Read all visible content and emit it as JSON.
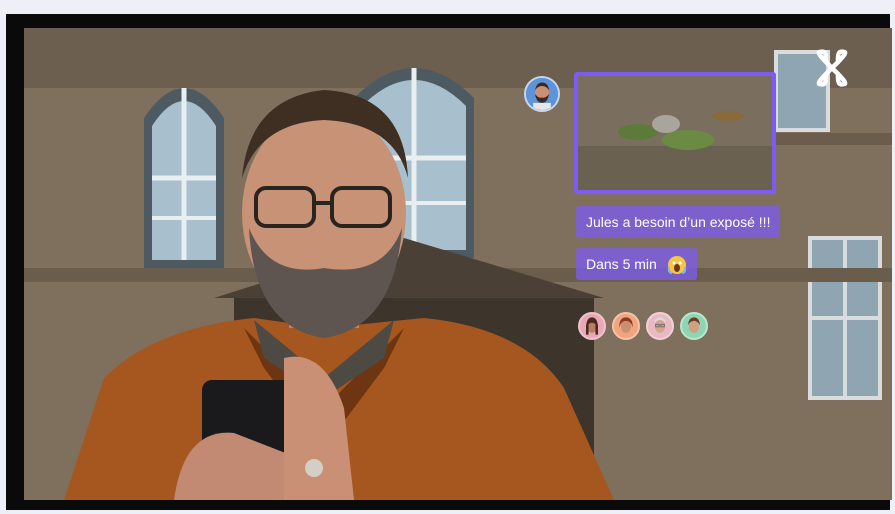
{
  "chat": {
    "message_1": "Jules a besoin d’un exposé !!!",
    "message_2": "Dans 5 min"
  },
  "icons": {
    "logo": "command-knot-logo-icon",
    "emoji": "screaming-face-emoji-icon"
  },
  "colors": {
    "accent": "#7d5cf3",
    "bubble": "#7c5cec",
    "page_bg": "#eef0f7"
  }
}
